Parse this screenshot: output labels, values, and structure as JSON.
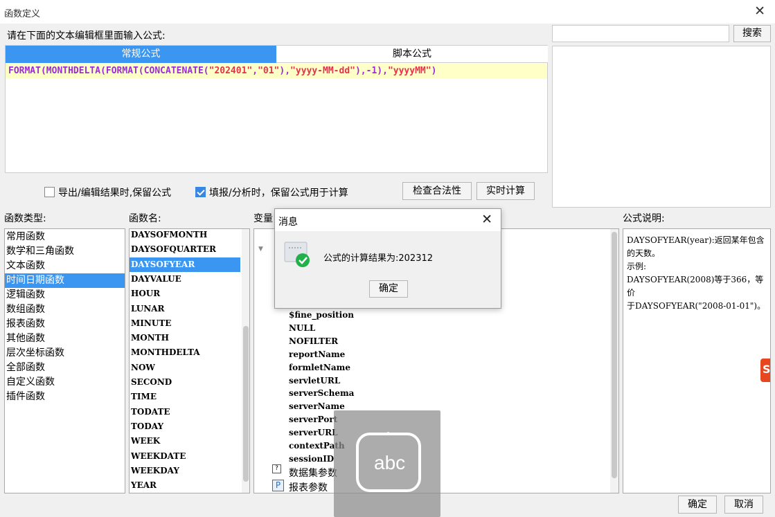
{
  "window": {
    "title": "函数定义",
    "close_symbol": "✕"
  },
  "prompt_label": "请在下面的文本编辑框里面输入公式:",
  "search": {
    "value": "",
    "button_label": "搜索"
  },
  "editor": {
    "tabs": [
      {
        "label": "常规公式",
        "active": true
      },
      {
        "label": "脚本公式",
        "active": false
      }
    ],
    "formula_tokens": [
      {
        "t": "FORMAT",
        "c": "fn"
      },
      {
        "t": "(",
        "c": "punc"
      },
      {
        "t": "MONTHDELTA",
        "c": "fn"
      },
      {
        "t": "(",
        "c": "punc"
      },
      {
        "t": "FORMAT",
        "c": "fn"
      },
      {
        "t": "(",
        "c": "punc"
      },
      {
        "t": "CONCATENATE",
        "c": "fn"
      },
      {
        "t": "(",
        "c": "punc"
      },
      {
        "t": "\"202401\"",
        "c": "str"
      },
      {
        "t": ",",
        "c": "punc"
      },
      {
        "t": "\"01\"",
        "c": "str"
      },
      {
        "t": "),",
        "c": "punc"
      },
      {
        "t": "\"yyyy-MM-dd\"",
        "c": "str"
      },
      {
        "t": "),-1),",
        "c": "punc"
      },
      {
        "t": "\"yyyyMM\"",
        "c": "str"
      },
      {
        "t": ")",
        "c": "punc"
      }
    ]
  },
  "options": {
    "keep_formula_export": {
      "label": "导出/编辑结果时,保留公式",
      "checked": false
    },
    "keep_formula_fill": {
      "label": "填报/分析时，保留公式用于计算",
      "checked": true
    },
    "check_button": "检查合法性",
    "realtime_button": "实时计算"
  },
  "labels": {
    "function_type": "函数类型:",
    "function_name": "函数名:",
    "variables": "变量",
    "formula_description": "公式说明:"
  },
  "function_types": [
    {
      "label": "常用函数",
      "selected": false
    },
    {
      "label": "数学和三角函数",
      "selected": false
    },
    {
      "label": "文本函数",
      "selected": false
    },
    {
      "label": "时间日期函数",
      "selected": true
    },
    {
      "label": "逻辑函数",
      "selected": false
    },
    {
      "label": "数组函数",
      "selected": false
    },
    {
      "label": "报表函数",
      "selected": false
    },
    {
      "label": "其他函数",
      "selected": false
    },
    {
      "label": "层次坐标函数",
      "selected": false
    },
    {
      "label": "全部函数",
      "selected": false
    },
    {
      "label": "自定义函数",
      "selected": false
    },
    {
      "label": "插件函数",
      "selected": false
    }
  ],
  "function_names": [
    {
      "label": "DAYSOFMONTH",
      "selected": false
    },
    {
      "label": "DAYSOFQUARTER",
      "selected": false
    },
    {
      "label": "DAYSOFYEAR",
      "selected": true
    },
    {
      "label": "DAYVALUE",
      "selected": false
    },
    {
      "label": "HOUR",
      "selected": false
    },
    {
      "label": "LUNAR",
      "selected": false
    },
    {
      "label": "MINUTE",
      "selected": false
    },
    {
      "label": "MONTH",
      "selected": false
    },
    {
      "label": "MONTHDELTA",
      "selected": false
    },
    {
      "label": "NOW",
      "selected": false
    },
    {
      "label": "SECOND",
      "selected": false
    },
    {
      "label": "TIME",
      "selected": false
    },
    {
      "label": "TODATE",
      "selected": false
    },
    {
      "label": "TODAY",
      "selected": false
    },
    {
      "label": "WEEK",
      "selected": false
    },
    {
      "label": "WEEKDATE",
      "selected": false
    },
    {
      "label": "WEEKDAY",
      "selected": false
    },
    {
      "label": "YEAR",
      "selected": false
    }
  ],
  "variables": [
    "$fine_position",
    "NULL",
    "NOFILTER",
    "reportName",
    "formletName",
    "servletURL",
    "serverSchema",
    "serverName",
    "serverPort",
    "serverURL",
    "contextPath",
    "sessionID"
  ],
  "variable_groups": [
    {
      "label": "数据集参数",
      "icon": "dataset-param-icon"
    },
    {
      "label": "报表参数",
      "icon": "report-param-icon",
      "badge": "P"
    }
  ],
  "description": "DAYSOFYEAR(year):返回某年包含的天数。\n示例:\nDAYSOFYEAR(2008)等于366，等价\n于DAYSOFYEAR(\"2008-01-01\")。",
  "message_dialog": {
    "title": "消息",
    "message": "公式的计算结果为:202312",
    "ok_label": "确定",
    "close_symbol": "✕",
    "icon": "success-check-icon"
  },
  "ime_overlay": {
    "text": "abc"
  },
  "footer": {
    "ok_label": "确定",
    "cancel_label": "取消"
  },
  "colors": {
    "accent": "#3a96f0",
    "function_token": "#9b2cd6",
    "string_token": "#e4324e",
    "editor_line_bg": "#ffffc8",
    "success": "#22b04b"
  }
}
